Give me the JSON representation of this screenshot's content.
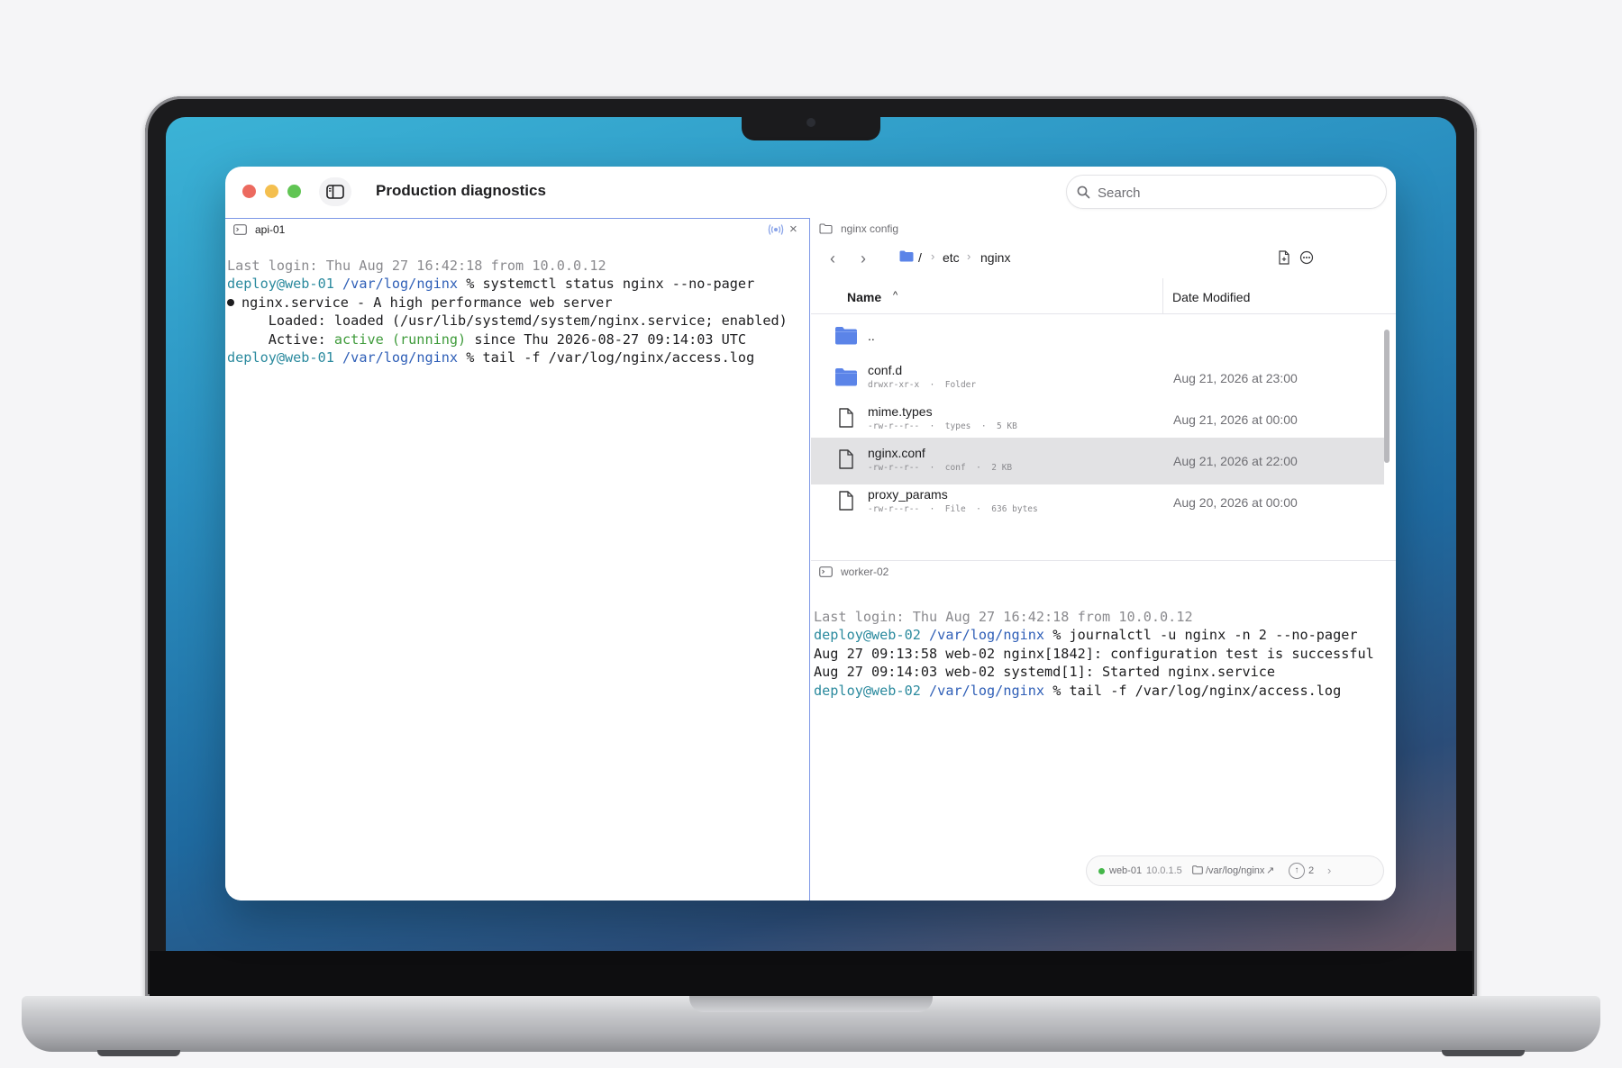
{
  "window": {
    "title": "Production diagnostics",
    "search_placeholder": "Search"
  },
  "left_pane": {
    "title": "api-01",
    "lines": [
      {
        "segments": [
          {
            "t": "Last login: Thu Aug 27 16:42:18 from 10.0.0.12",
            "c": "dim"
          }
        ]
      },
      {
        "segments": [
          {
            "t": "deploy@web-01",
            "c": "user"
          },
          {
            "t": " "
          },
          {
            "t": "/var/log/nginx",
            "c": "path"
          },
          {
            "t": " % systemctl status nginx --no-pager"
          }
        ]
      },
      {
        "bullet": true,
        "segments": [
          {
            "t": "nginx.service - A high performance web server"
          }
        ]
      },
      {
        "segments": [
          {
            "t": "     Loaded: loaded (/usr/lib/systemd/system/nginx.service; enabled)"
          }
        ]
      },
      {
        "segments": [
          {
            "t": "     Active: "
          },
          {
            "t": "active (running)",
            "c": "ok"
          },
          {
            "t": " since Thu 2026-08-27 09:14:03 UTC"
          }
        ]
      },
      {
        "segments": [
          {
            "t": "deploy@web-01",
            "c": "user"
          },
          {
            "t": " "
          },
          {
            "t": "/var/log/nginx",
            "c": "path"
          },
          {
            "t": " % tail -f /var/log/nginx/access.log"
          }
        ]
      }
    ]
  },
  "file_pane": {
    "title": "nginx config",
    "breadcrumb": [
      "/",
      "etc",
      "nginx"
    ],
    "columns": {
      "name": "Name",
      "date": "Date Modified"
    },
    "rows": [
      {
        "name": "..",
        "kind": "folder",
        "meta": "",
        "date": "",
        "selected": false
      },
      {
        "name": "conf.d",
        "kind": "folder",
        "meta": "drwxr-xr-x  ·  Folder",
        "date": "Aug 21, 2026 at 23:00",
        "selected": false
      },
      {
        "name": "mime.types",
        "kind": "file",
        "meta": "-rw-r--r--  ·  types  ·  5 KB",
        "date": "Aug 21, 2026 at 00:00",
        "selected": false
      },
      {
        "name": "nginx.conf",
        "kind": "file",
        "meta": "-rw-r--r--  ·  conf  ·  2 KB",
        "date": "Aug 21, 2026 at 22:00",
        "selected": true
      },
      {
        "name": "proxy_params",
        "kind": "file",
        "meta": "-rw-r--r--  ·  File  ·  636 bytes",
        "date": "Aug 20, 2026 at 00:00",
        "selected": false
      }
    ]
  },
  "bottom_pane": {
    "title": "worker-02",
    "lines": [
      {
        "segments": [
          {
            "t": "Last login: Thu Aug 27 16:42:18 from 10.0.0.12",
            "c": "dim"
          }
        ]
      },
      {
        "segments": [
          {
            "t": "deploy@web-02",
            "c": "user"
          },
          {
            "t": " "
          },
          {
            "t": "/var/log/nginx",
            "c": "path"
          },
          {
            "t": " % journalctl -u nginx -n 2 --no-pager"
          }
        ]
      },
      {
        "segments": [
          {
            "t": "Aug 27 09:13:58 web-02 nginx[1842]: configuration test is successful"
          }
        ]
      },
      {
        "segments": [
          {
            "t": "Aug 27 09:14:03 web-02 systemd[1]: Started nginx.service"
          }
        ]
      },
      {
        "segments": [
          {
            "t": "deploy@web-02",
            "c": "user"
          },
          {
            "t": " "
          },
          {
            "t": "/var/log/nginx",
            "c": "path"
          },
          {
            "t": " % tail -f /var/log/nginx/access.log"
          }
        ]
      }
    ]
  },
  "status": {
    "host": "web-01",
    "ip": "10.0.1.5",
    "path": "/var/log/nginx",
    "path_arrow": "↗",
    "upload_count": "2",
    "status_color": "#45b74a"
  },
  "colors": {
    "accent": "#2f5fb7",
    "user": "#2b8a9e",
    "ok": "#3f9b3b",
    "folder": "#5b84e8"
  }
}
